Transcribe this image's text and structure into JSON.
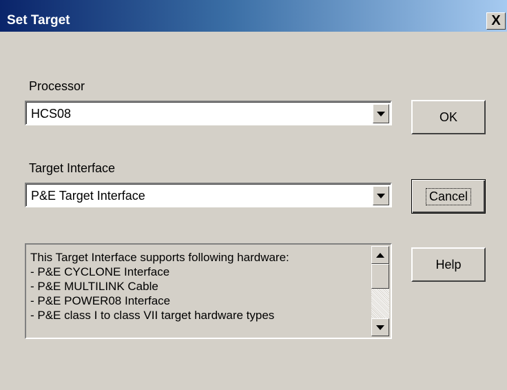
{
  "dialog": {
    "title": "Set Target",
    "close_label": "X"
  },
  "processor": {
    "label": "Processor",
    "selected": "HCS08"
  },
  "target_interface": {
    "label": "Target Interface",
    "selected": "P&E Target Interface"
  },
  "buttons": {
    "ok": "OK",
    "cancel": "Cancel",
    "help": "Help"
  },
  "info_list": {
    "lines": [
      "This Target Interface supports following hardware:",
      "- P&E CYCLONE Interface",
      "- P&E MULTILINK Cable",
      "- P&E POWER08 Interface",
      "- P&E class I to class VII target hardware types"
    ]
  },
  "icons": {
    "dropdown": "chevron-down-icon",
    "scroll_up": "scroll-up-arrow-icon",
    "scroll_down": "scroll-down-arrow-icon"
  },
  "colors": {
    "titlebar_start": "#0a246a",
    "titlebar_end": "#a6caf0",
    "face": "#d4d0c8"
  }
}
